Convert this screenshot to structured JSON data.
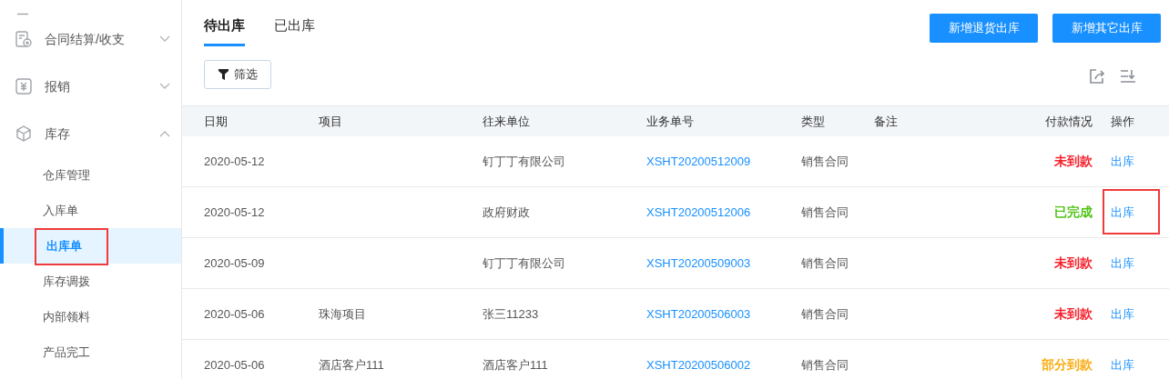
{
  "sidebar": {
    "groups": [
      {
        "label": "合同结算/收支",
        "expanded": false
      },
      {
        "label": "报销",
        "expanded": false
      },
      {
        "label": "库存",
        "expanded": true,
        "children": [
          {
            "label": "仓库管理",
            "selected": false,
            "highlighted": false
          },
          {
            "label": "入库单",
            "selected": false,
            "highlighted": false
          },
          {
            "label": "出库单",
            "selected": true,
            "highlighted": true
          },
          {
            "label": "库存调拨",
            "selected": false,
            "highlighted": false
          },
          {
            "label": "内部领料",
            "selected": false,
            "highlighted": false
          },
          {
            "label": "产品完工",
            "selected": false,
            "highlighted": false
          }
        ]
      }
    ]
  },
  "tabs": [
    {
      "label": "待出库",
      "selected": true
    },
    {
      "label": "已出库",
      "selected": false
    }
  ],
  "buttons": [
    "新增退货出库",
    "新增其它出库"
  ],
  "filter": {
    "label": "筛选"
  },
  "table": {
    "columns": [
      "日期",
      "项目",
      "往来单位",
      "业务单号",
      "类型",
      "备注",
      "付款情况",
      "操作"
    ],
    "rows": [
      {
        "date": "2020-05-12",
        "project": "",
        "partner": "钉丁丁有限公司",
        "number": "XSHT20200512009",
        "type": "销售合同",
        "payment": "未到款",
        "color": "#f5222d",
        "action": "出库",
        "highlighted": false
      },
      {
        "date": "2020-05-12",
        "project": "",
        "partner": "政府财政",
        "number": "XSHT20200512006",
        "type": "销售合同",
        "payment": "已完成",
        "color": "#52c41a",
        "action": "出库",
        "highlighted": true
      },
      {
        "date": "2020-05-09",
        "project": "",
        "partner": "钉丁丁有限公司",
        "number": "XSHT20200509003",
        "type": "销售合同",
        "payment": "未到款",
        "color": "#f5222d",
        "action": "出库",
        "highlighted": false
      },
      {
        "date": "2020-05-06",
        "project": "珠海项目",
        "partner": "张三11233",
        "number": "XSHT20200506003",
        "type": "销售合同",
        "payment": "未到款",
        "color": "#f5222d",
        "action": "出库",
        "highlighted": false
      },
      {
        "date": "2020-05-06",
        "project": "酒店客户111",
        "partner": "酒店客户111",
        "number": "XSHT20200506002",
        "type": "销售合同",
        "payment": "部分到款",
        "color": "#faad14",
        "action": "出库",
        "highlighted": false
      }
    ]
  }
}
